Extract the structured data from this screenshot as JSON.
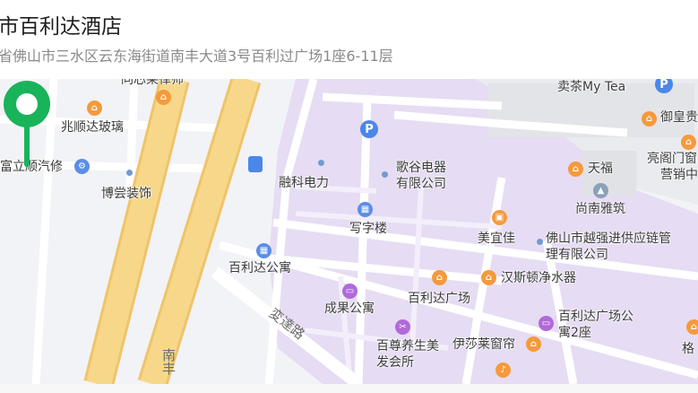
{
  "header": {
    "title": "市百利达酒店",
    "address": "省佛山市三水区云东海街道南丰大道3号百利过广场1座6-11层"
  },
  "colors": {
    "map_base": "#f2f3f6",
    "district": "#e6dcf3",
    "major_road": "#f7d88a",
    "pin": "#19b35a"
  },
  "map": {
    "labels": {
      "xinlai": "同芯莱律师",
      "zhaoshun": "兆顺达玻璃",
      "fuli": "富立顺汽修",
      "bochang": "博尝装饰",
      "maicha": "卖茶My Tea",
      "yuhuang": "御皇贵",
      "lianggemen": "亮阁门窗",
      "yingxiao": "营销中",
      "tianfu": "天福",
      "shangnan": "尚南雅筑",
      "rongke": "融科电力",
      "gegu": "歌谷电器有限公司",
      "xiezilou": "写字楼",
      "meiyijia": "美宜佳",
      "foshan_yueqiang": "佛山市越强进供应链管理有限公司",
      "bailida_apt": "百利达公寓",
      "chengguo": "成果公寓",
      "bailida_plaza": "百利达广场",
      "hansidun": "汉斯顿净水器",
      "bailida_apt2": "百利达广场公寓2座",
      "baizun": "百尊养生美发会所",
      "yishalai": "伊莎莱窗帘",
      "ge": "格",
      "bianda_road": "変達路",
      "nan_road": "南丰"
    },
    "icons": {
      "parking": "parking-icon",
      "bus": "bus-stop-icon",
      "pin": "location-pin-icon"
    },
    "parking_letter": "P"
  }
}
